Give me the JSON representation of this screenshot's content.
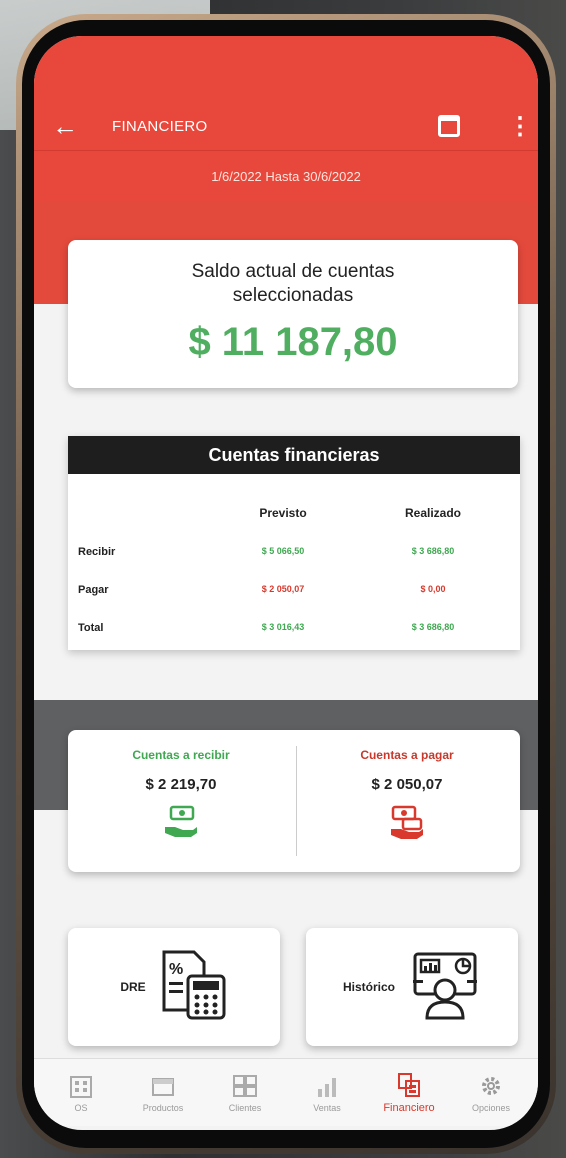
{
  "app": {
    "title": "FINANCIERO",
    "date_range": "1/6/2022 Hasta 30/6/2022"
  },
  "saldo": {
    "label": "Saldo actual de cuentas seleccionadas",
    "value": "$ 11 187,80"
  },
  "cuentas": {
    "title": "Cuentas financieras",
    "col_previsto": "Previsto",
    "col_realizado": "Realizado",
    "rows": [
      {
        "label": "Recibir",
        "previsto": "$ 5 066,50",
        "realizado": "$ 3 686,80"
      },
      {
        "label": "Pagar",
        "previsto": "$ 2 050,07",
        "realizado": "$ 0,00"
      },
      {
        "label": "Total",
        "previsto": "$ 3 016,43",
        "realizado": "$ 3 686,80"
      }
    ]
  },
  "summary": {
    "recibir_title": "Cuentas a recibir",
    "recibir_amount": "$ 2 219,70",
    "pagar_title": "Cuentas a pagar",
    "pagar_amount": "$ 2 050,07"
  },
  "tiles": {
    "dre_label": "DRE",
    "historico_label": "Histórico"
  },
  "nav": {
    "items": [
      {
        "label": "OS",
        "icon": "building-icon"
      },
      {
        "label": "Productos",
        "icon": "box-icon"
      },
      {
        "label": "Clientes",
        "icon": "clients-icon"
      },
      {
        "label": "Ventas",
        "icon": "bar-chart-icon"
      },
      {
        "label": "Financiero",
        "icon": "finance-icon"
      },
      {
        "label": "Opciones",
        "icon": "gear-icon"
      }
    ],
    "active": "Financiero"
  },
  "colors": {
    "primary": "#e8473b",
    "positive": "#4fae60",
    "negative": "#d8392c"
  }
}
